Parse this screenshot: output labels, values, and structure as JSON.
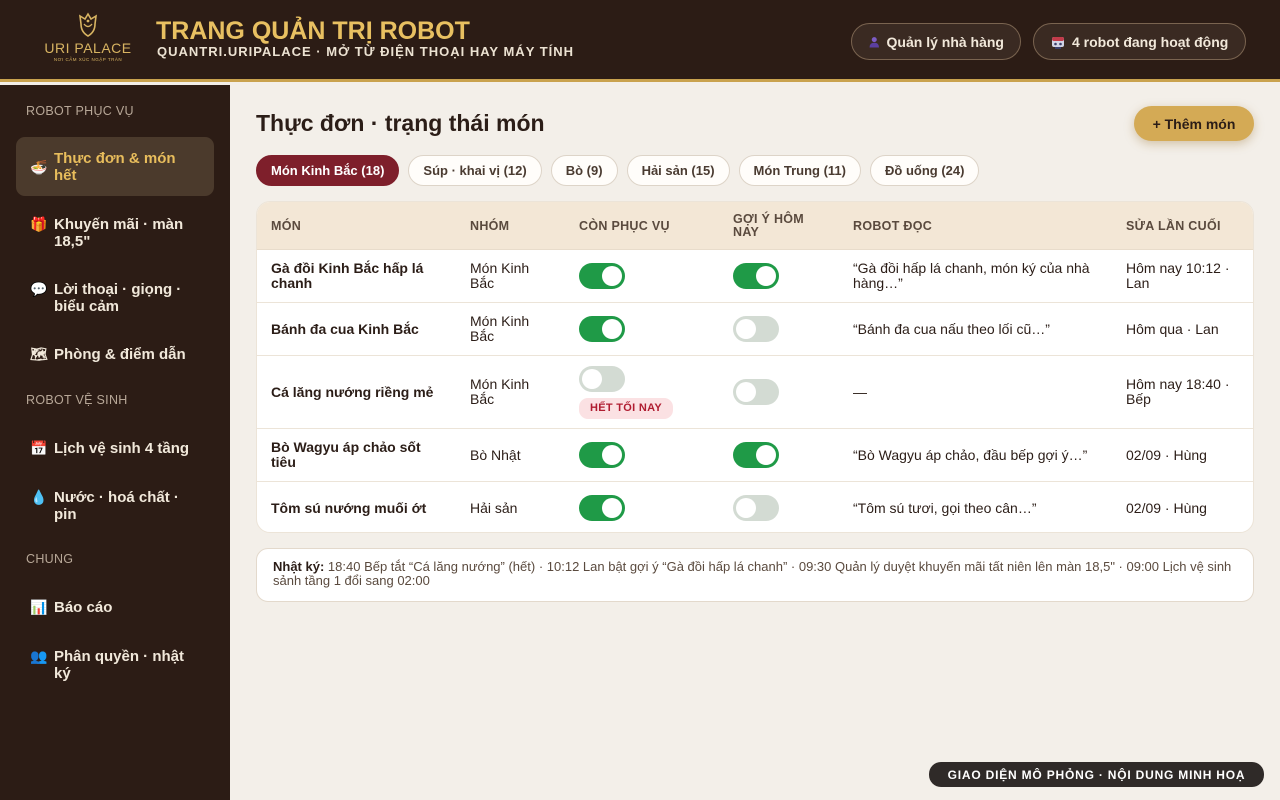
{
  "header": {
    "logo_brand": "URI PALACE",
    "logo_tagline": "NƠI CẢM XÚC NGẬP TRÀN",
    "title": "TRANG QUẢN TRỊ ROBOT",
    "subtitle": "QUANTRI.URIPALACE · MỞ TỪ ĐIỆN THOẠI HAY MÁY TÍNH",
    "manager_button": "Quản lý nhà hàng",
    "manager_icon": "person-icon",
    "robots_button": "4 robot đang hoạt động",
    "robots_icon": "robot-icon"
  },
  "sidebar": {
    "sections": [
      "ROBOT PHỤC VỤ",
      "ROBOT VỆ SINH",
      "CHUNG"
    ],
    "items": [
      {
        "label": "Thực đơn & món hết",
        "icon": "food-bowl-icon",
        "glyph": "🍜",
        "active": true
      },
      {
        "label": "Khuyến mãi · màn 18,5\"",
        "icon": "gift-icon",
        "glyph": "🎁"
      },
      {
        "label": "Lời thoại · giọng · biểu cảm",
        "icon": "speech-bubble-icon",
        "glyph": "💬"
      },
      {
        "label": "Phòng & điểm dẫn",
        "icon": "map-icon",
        "glyph": "🗺"
      },
      {
        "label": "Lịch vệ sinh 4 tầng",
        "icon": "calendar-icon",
        "glyph": "📅"
      },
      {
        "label": "Nước · hoá chất · pin",
        "icon": "water-drop-icon",
        "glyph": "💧"
      },
      {
        "label": "Báo cáo",
        "icon": "bar-chart-icon",
        "glyph": "📊"
      },
      {
        "label": "Phân quyền · nhật ký",
        "icon": "people-icon",
        "glyph": "👥"
      }
    ]
  },
  "main": {
    "title": "Thực đơn · trạng thái món",
    "add_button": "+ Thêm món",
    "tabs": [
      {
        "label": "Món Kinh Bắc (18)",
        "active": true
      },
      {
        "label": "Súp · khai vị (12)"
      },
      {
        "label": "Bò (9)"
      },
      {
        "label": "Hải sản (15)"
      },
      {
        "label": "Món Trung (11)"
      },
      {
        "label": "Đồ uống (24)"
      }
    ],
    "table": {
      "columns": [
        "MÓN",
        "NHÓM",
        "CÒN PHỤC VỤ",
        "GỢI Ý HÔM NAY",
        "ROBOT ĐỌC",
        "SỬA LẦN CUỐI"
      ],
      "rows": [
        {
          "dish": "Gà đồi Kinh Bắc hấp lá chanh",
          "group": "Món Kinh Bắc",
          "serving": true,
          "suggest": true,
          "robot_reads": "“Gà đồi hấp lá chanh, món ký của nhà hàng…”",
          "last_edit": "Hôm nay 10:12 · Lan"
        },
        {
          "dish": "Bánh đa cua Kinh Bắc",
          "group": "Món Kinh Bắc",
          "serving": true,
          "suggest": false,
          "robot_reads": "“Bánh đa cua nấu theo lối cũ…”",
          "last_edit": "Hôm qua · Lan"
        },
        {
          "dish": "Cá lăng nướng riềng mẻ",
          "group": "Món Kinh Bắc",
          "serving": false,
          "badge": "HẾT TỐI NAY",
          "suggest": false,
          "robot_reads": "—",
          "last_edit": "Hôm nay 18:40 · Bếp"
        },
        {
          "dish": "Bò Wagyu áp chảo sốt tiêu",
          "group": "Bò Nhật",
          "serving": true,
          "suggest": true,
          "robot_reads": "“Bò Wagyu áp chảo, đầu bếp gợi ý…”",
          "last_edit": "02/09 · Hùng"
        },
        {
          "dish": "Tôm sú nướng muối ớt",
          "group": "Hải sản",
          "serving": true,
          "suggest": false,
          "robot_reads": "“Tôm sú tươi, gọi theo cân…”",
          "last_edit": "02/09 · Hùng"
        }
      ]
    },
    "log": {
      "label": "Nhật ký:",
      "text": "18:40 Bếp tắt “Cá lăng nướng” (hết) · 10:12 Lan bật gợi ý “Gà đồi hấp lá chanh” · 09:30 Quản lý duyệt khuyến mãi tất niên lên màn 18,5\" · 09:00 Lịch vệ sinh sảnh tầng 1 đổi sang 02:00"
    }
  },
  "footer": {
    "note": "GIAO DIỆN MÔ PHỎNG · NỘI DUNG MINH HOẠ"
  },
  "colors": {
    "header_bg": "#2c1c15",
    "gold": "#e8c061",
    "accent_red": "#7e1f2b",
    "toggle_on": "#1f9a47",
    "badge_red": "#b01d31"
  }
}
